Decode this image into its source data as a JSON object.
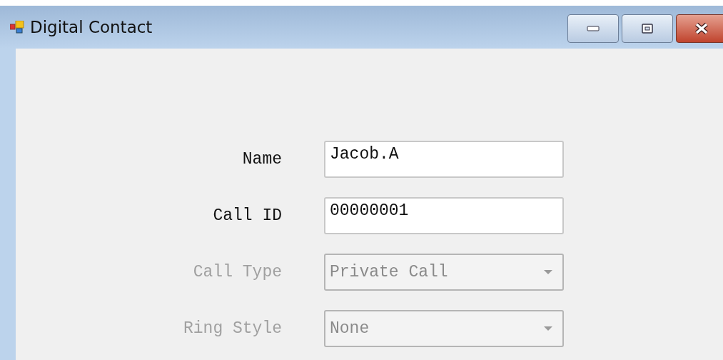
{
  "window": {
    "title": "Digital Contact"
  },
  "fields": [
    {
      "label": "Name",
      "kind": "text",
      "value": "Jacob.A",
      "disabled": false
    },
    {
      "label": "Call ID",
      "kind": "text",
      "value": "00000001",
      "disabled": false
    },
    {
      "label": "Call Type",
      "kind": "dropdown",
      "value": "Private Call",
      "disabled": true
    },
    {
      "label": "Ring Style",
      "kind": "dropdown",
      "value": "None",
      "disabled": true
    }
  ]
}
